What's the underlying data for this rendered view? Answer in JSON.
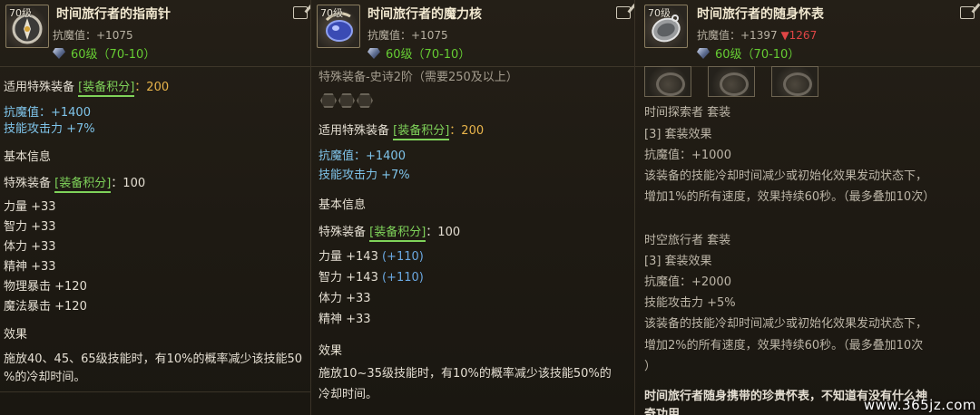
{
  "panels": [
    {
      "icon": "compass-icon",
      "level_badge": "70级",
      "name": "时间旅行者的指南针",
      "resist": "抗魔值：+1075",
      "gem_level": "60级（70-10）",
      "lines": [
        {
          "t": "适用特殊装备 ",
          "tag": "[装备积分]",
          "after": "：200",
          "cls": "gold"
        },
        {
          "t": "抗魔值：+1400",
          "cls": "blue"
        },
        {
          "t": "技能攻击力 +7%",
          "cls": "blue"
        },
        {
          "t": "基本信息",
          "cls": "head"
        },
        {
          "t": "特殊装备 ",
          "tag": "[装备积分]",
          "after": "：100",
          "cls": "white"
        },
        {
          "t": "力量 +33",
          "cls": "white"
        },
        {
          "t": "智力 +33",
          "cls": "white"
        },
        {
          "t": "体力 +33",
          "cls": "white"
        },
        {
          "t": "精神 +33",
          "cls": "white"
        },
        {
          "t": "物理暴击 +120",
          "cls": "white"
        },
        {
          "t": "魔法暴击 +120",
          "cls": "white"
        },
        {
          "t": "效果",
          "cls": "head"
        },
        {
          "t": "施放40、45、65级技能时，有10%的概率减少该技能50",
          "cls": "white"
        },
        {
          "t": "%的冷却时间。",
          "cls": "white"
        }
      ]
    },
    {
      "icon": "magic-core-icon",
      "level_badge": "70级",
      "name": "时间旅行者的魔力核",
      "resist": "抗魔值：+1075",
      "gem_level": "60级（70-10）",
      "tier": "特殊装备-史诗2阶（需要250及以上）",
      "lines": [
        {
          "t": "适用特殊装备 ",
          "tag": "[装备积分]",
          "after": "：200",
          "cls": "gold"
        },
        {
          "t": "抗魔值：+1400",
          "cls": "blue"
        },
        {
          "t": "技能攻击力 +7%",
          "cls": "blue"
        },
        {
          "t": "基本信息",
          "cls": "head"
        },
        {
          "t": "特殊装备 ",
          "tag": "[装备积分]",
          "after": "：100",
          "cls": "white"
        },
        {
          "t": "力量 +143 ",
          "extra": "(+110)",
          "cls": "white"
        },
        {
          "t": "智力 +143 ",
          "extra": "(+110)",
          "cls": "white"
        },
        {
          "t": "体力 +33",
          "cls": "white"
        },
        {
          "t": "精神 +33",
          "cls": "white"
        },
        {
          "t": "效果",
          "cls": "head"
        },
        {
          "t": "施放10~35级技能时，有10%的概率减少该技能50%的",
          "cls": "white"
        },
        {
          "t": "冷却时间。",
          "cls": "white"
        }
      ]
    },
    {
      "icon": "pocket-watch-icon",
      "level_badge": "70级",
      "name": "时间旅行者的随身怀表",
      "resist": "抗魔值：+1397",
      "resist_diff": "▼1267",
      "gem_level": "60级（70-10）",
      "lines": [
        {
          "t": "时间探索者  套装",
          "cls": "grey"
        },
        {
          "t": "[3] 套装效果",
          "cls": "grey"
        },
        {
          "t": "抗魔值：+1000",
          "cls": "grey"
        },
        {
          "t": "该装备的技能冷却时间减少或初始化效果发动状态下，",
          "cls": "grey"
        },
        {
          "t": "增加1%的所有速度，效果持续60秒。（最多叠加10次）",
          "cls": "grey"
        },
        {
          "t": "时空旅行者  套装",
          "cls": "grey"
        },
        {
          "t": "[3] 套装效果",
          "cls": "grey"
        },
        {
          "t": "抗魔值：+2000",
          "cls": "grey"
        },
        {
          "t": "技能攻击力 +5%",
          "cls": "grey"
        },
        {
          "t": "该装备的技能冷却时间减少或初始化效果发动状态下，",
          "cls": "grey"
        },
        {
          "t": "增加2%的所有速度，效果持续60秒。（最多叠加10次",
          "cls": "grey"
        },
        {
          "t": "）",
          "cls": "grey"
        },
        {
          "t": "时间旅行者随身携带的珍贵怀表，不知道有没有什么神",
          "cls": "white"
        },
        {
          "t": "奇功用",
          "cls": "white"
        }
      ]
    }
  ],
  "watermark": "www.365jz.com",
  "colors": {
    "tag_green": "#7fd35a",
    "gold": "#e8b44b",
    "blue": "#7fc4ea",
    "red": "#e04545"
  }
}
